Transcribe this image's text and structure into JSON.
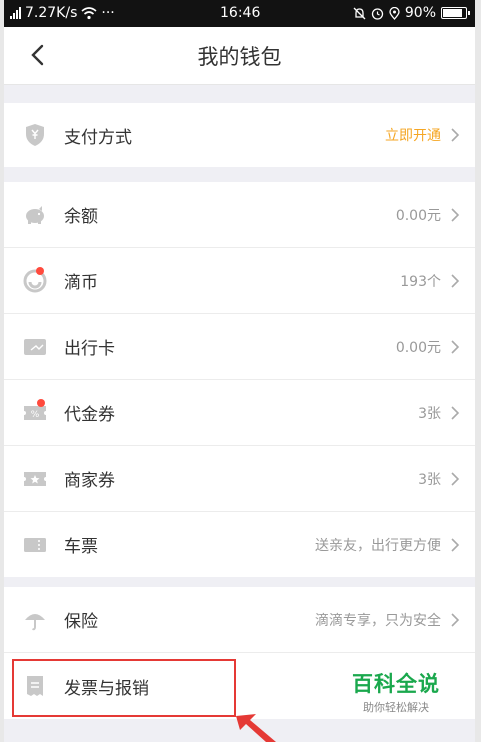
{
  "status_bar": {
    "network_type": "4G",
    "speed": "7.27K/s",
    "dots": "···",
    "time": "16:46",
    "battery": "90%",
    "battery_level": 0.9
  },
  "header": {
    "title": "我的钱包",
    "back_icon": "chevron-left-icon"
  },
  "payment": {
    "label": "支付方式",
    "value": "立即开通",
    "icon": "shield-yen-icon",
    "accent_color": "#f5a623"
  },
  "wallet_items": [
    {
      "label": "余额",
      "value": "0.00元",
      "icon": "piggy-bank-icon"
    },
    {
      "label": "滴币",
      "value": "193个",
      "icon": "didi-coin-icon",
      "has_red_dot": true
    },
    {
      "label": "出行卡",
      "value": "0.00元",
      "icon": "card-icon"
    },
    {
      "label": "代金券",
      "value": "3张",
      "icon": "voucher-percent-icon",
      "has_red_dot": true
    },
    {
      "label": "商家券",
      "value": "3张",
      "icon": "star-ticket-icon"
    },
    {
      "label": "车票",
      "value": "送亲友，出行更方便",
      "icon": "ticket-icon"
    }
  ],
  "extra_items": [
    {
      "label": "保险",
      "value": "滴滴专享，只为安全",
      "icon": "umbrella-icon"
    },
    {
      "label": "发票与报销",
      "value": "",
      "icon": "receipt-icon"
    }
  ],
  "watermark": {
    "title": "百科全说",
    "subtitle": "助你轻松解决"
  },
  "colors": {
    "red_dot": "#ff4a3d",
    "highlight_border": "#e53935",
    "watermark_green": "#1aa84d",
    "icon_gray": "#c8c8c8"
  }
}
